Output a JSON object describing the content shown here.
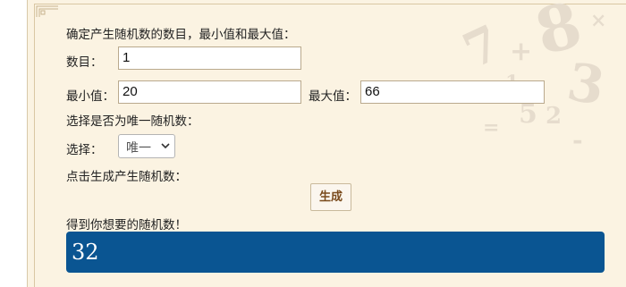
{
  "form": {
    "heading": "确定产生随机数的数目，最小值和最大值：",
    "count_label": "数目：",
    "count_value": "1",
    "min_label": "最小值：",
    "min_value": "20",
    "max_label": "最大值：",
    "max_value": "66",
    "unique_heading": "选择是否为唯一随机数：",
    "select_label": "选择：",
    "select_value": "唯一",
    "generate_prompt": "点击生成产生随机数：",
    "generate_button": "生成",
    "result_label": "得到你想要的随机数！",
    "result_value": "32"
  },
  "decoration": {
    "glyphs": [
      "8",
      "3",
      "7",
      "5",
      "2",
      "1",
      "+",
      "×",
      "-",
      "="
    ]
  },
  "colors": {
    "background": "#fbf3e2",
    "result_bar": "#0a5592",
    "button_text": "#7a4b1d"
  }
}
